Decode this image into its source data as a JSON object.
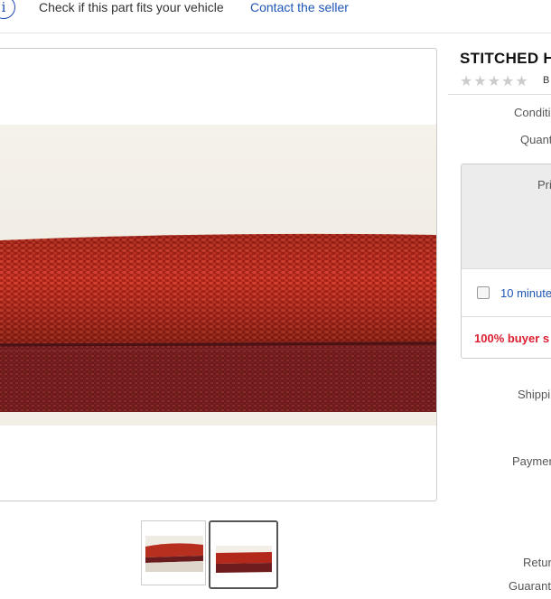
{
  "topbar": {
    "info_icon": "i",
    "fits_text": "Check if this part fits your vehicle",
    "contact_link": "Contact the seller"
  },
  "gallery": {
    "main_image": "red stitched strap close-up",
    "thumbnails": [
      {
        "label": "thumbnail-1"
      },
      {
        "label": "thumbnail-2",
        "selected": true
      }
    ]
  },
  "listing": {
    "title": "STITCHED H",
    "stars": "★★★★★",
    "star_text": "B",
    "condition_label": "Conditi",
    "quantity_label": "Quant",
    "price_label": "Pri",
    "minutes_text": "10 minute",
    "buyer_text": "100% buyer s",
    "shipping_label": "Shippi",
    "payments_label": "Paymer",
    "returns_label": "Retur",
    "guarantee_label": "Guarant"
  },
  "colors": {
    "link": "#1f56b6",
    "alert": "#dd1e31",
    "strap_top": "#b52a1f",
    "strap_bottom": "#6e1d1f"
  }
}
